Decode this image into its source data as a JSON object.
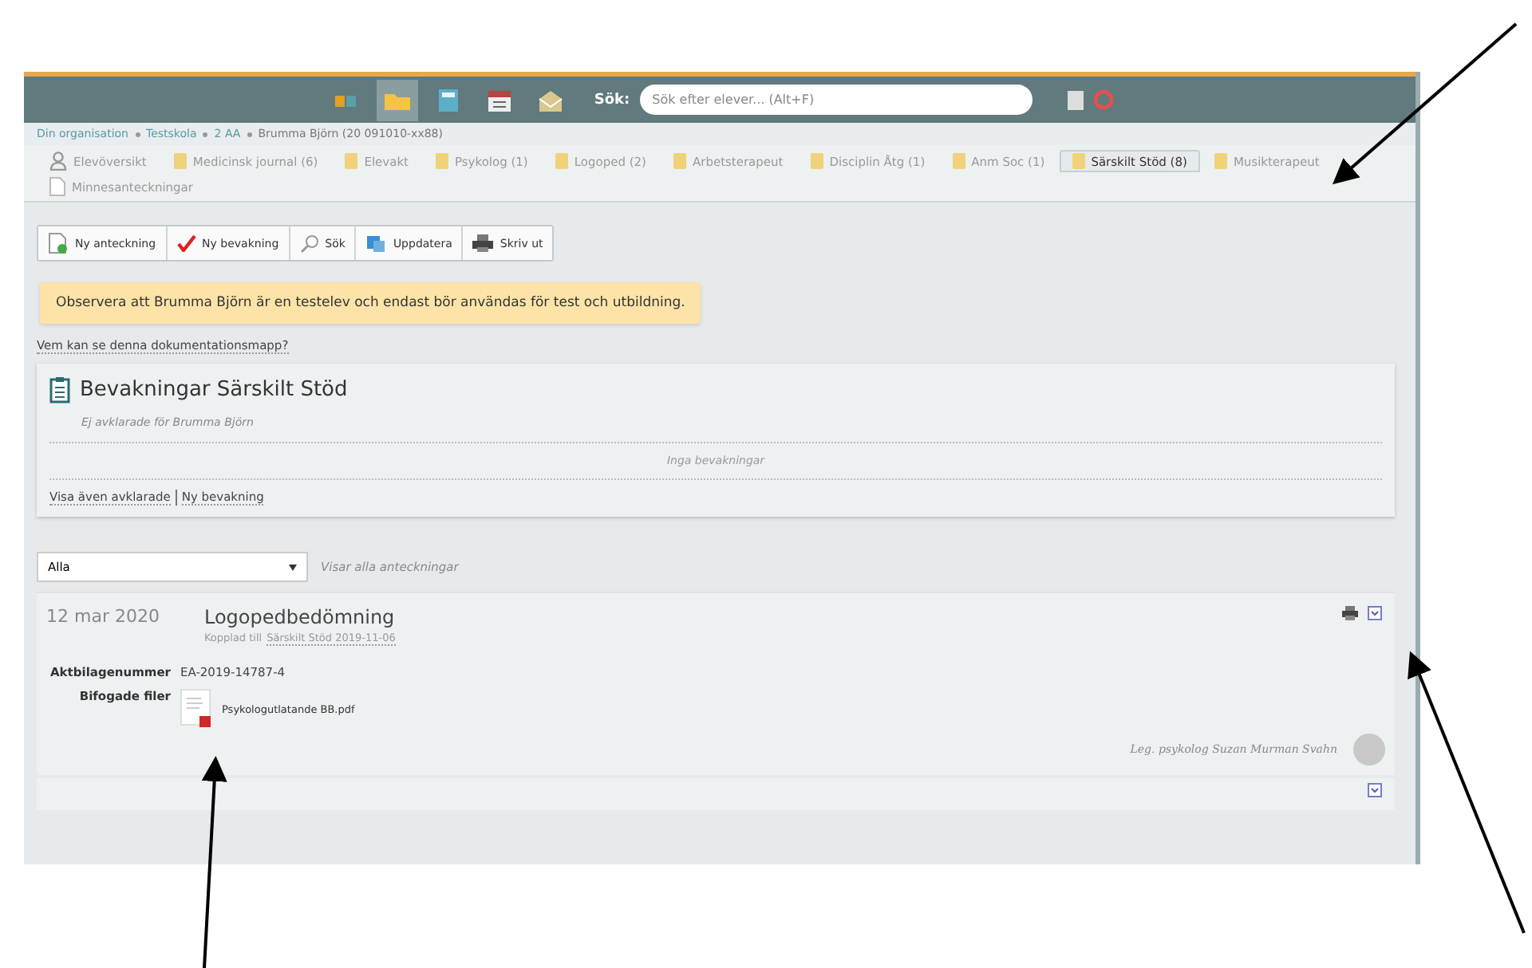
{
  "topbar": {
    "icons": [
      {
        "kind": "books",
        "selected": false
      },
      {
        "kind": "folder",
        "selected": true
      },
      {
        "kind": "calculator",
        "selected": false
      },
      {
        "kind": "calendar",
        "selected": false
      },
      {
        "kind": "mail",
        "selected": false
      }
    ],
    "search_label": "Sök:",
    "search": {
      "placeholder": "Sök efter elever... (Alt+F)"
    }
  },
  "breadcrumb": [
    "Din organisation",
    "Testskola",
    "2 AA",
    "Brumma Björn (20 091010-xx88)"
  ],
  "tabs": [
    {
      "label": "Elevöversikt",
      "kind": "person",
      "selected": false
    },
    {
      "label": "Medicinsk journal (6)",
      "kind": "folder",
      "selected": false
    },
    {
      "label": "Elevakt",
      "kind": "folder",
      "selected": false
    },
    {
      "label": "Psykolog (1)",
      "kind": "folder",
      "selected": false
    },
    {
      "label": "Logoped (2)",
      "kind": "folder",
      "selected": false
    },
    {
      "label": "Arbetsterapeut",
      "kind": "folder",
      "selected": false
    },
    {
      "label": "Disciplin Åtg (1)",
      "kind": "folder",
      "selected": false
    },
    {
      "label": "Anm Soc (1)",
      "kind": "folder",
      "selected": false
    },
    {
      "label": "Särskilt Stöd (8)",
      "kind": "folder",
      "selected": true
    },
    {
      "label": "Musikterapeut",
      "kind": "folder",
      "selected": false
    },
    {
      "label": "Minnesanteckningar",
      "kind": "note",
      "selected": false
    }
  ],
  "toolbar": [
    {
      "label": "Ny anteckning",
      "kind": "new-note"
    },
    {
      "label": "Ny bevakning",
      "kind": "check"
    },
    {
      "label": "Sök",
      "kind": "search"
    },
    {
      "label": "Uppdatera",
      "kind": "refresh"
    },
    {
      "label": "Skriv ut",
      "kind": "print"
    }
  ],
  "notice": "Observera att Brumma Björn är en testelev och endast bör användas för test och utbildning.",
  "who_link": "Vem kan se denna dokumentationsmapp?",
  "watch_card": {
    "title": "Bevakningar Särskilt Stöd",
    "subtitle": "Ej avklarade för Brumma Björn",
    "empty": "Inga bevakningar",
    "links": [
      "Visa även avklarade",
      "Ny bevakning"
    ]
  },
  "filter": {
    "value": "Alla",
    "note": "Visar alla anteckningar"
  },
  "entry": {
    "date": "12 mar 2020",
    "title": "Logopedbedömning",
    "linked_prefix": "Kopplad till",
    "linked": "Särskilt Stöd 2019-11-06",
    "fields": [
      {
        "label": "Aktbilagenummer",
        "value": "EA-2019-14787-4"
      }
    ],
    "files_label": "Bifogade filer",
    "files": [
      "Psykologutlatande BB.pdf"
    ],
    "signature": "Leg. psykolog Suzan Murman Svahn"
  }
}
